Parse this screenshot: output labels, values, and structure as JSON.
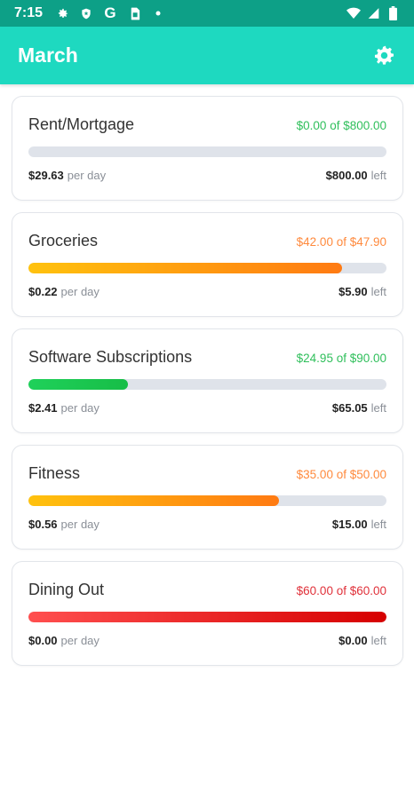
{
  "status_bar": {
    "time": "7:15",
    "left_icons": [
      "settings-icon",
      "shield-icon",
      "google-icon",
      "sim-card-icon",
      "dot-icon"
    ],
    "right_icons": [
      "wifi-icon",
      "signal-icon",
      "battery-icon"
    ]
  },
  "app_bar": {
    "title": "March",
    "settings_icon": "gear-icon",
    "background_color": "#1ed9c0"
  },
  "categories": [
    {
      "name": "Rent/Mortgage",
      "amount": "$0.00 of $800.00",
      "per_day": "$29.63",
      "per_day_unit": "per day",
      "left": "$800.00",
      "left_unit": "left",
      "progress": 0,
      "status": "green",
      "amount_color": "#2fbf5b",
      "bar_gradient": "#1fbe4a,#14c24a"
    },
    {
      "name": "Groceries",
      "amount": "$42.00 of $47.90",
      "per_day": "$0.22",
      "per_day_unit": "per day",
      "left": "$5.90",
      "left_unit": "left",
      "progress": 0.877,
      "status": "orange",
      "amount_color": "#ff8a3d",
      "bar_gradient": "#ffc20e,#ff7a12"
    },
    {
      "name": "Software Subscriptions",
      "amount": "$24.95 of $90.00",
      "per_day": "$2.41",
      "per_day_unit": "per day",
      "left": "$65.05",
      "left_unit": "left",
      "progress": 0.277,
      "status": "green",
      "amount_color": "#2fbf5b",
      "bar_gradient": "#1fd15a,#17bd47"
    },
    {
      "name": "Fitness",
      "amount": "$35.00 of $50.00",
      "per_day": "$0.56",
      "per_day_unit": "per day",
      "left": "$15.00",
      "left_unit": "left",
      "progress": 0.7,
      "status": "orange",
      "amount_color": "#ff8a3d",
      "bar_gradient": "#ffc20e,#ff7a12"
    },
    {
      "name": "Dining Out",
      "amount": "$60.00 of $60.00",
      "per_day": "$0.00",
      "per_day_unit": "per day",
      "left": "$0.00",
      "left_unit": "left",
      "progress": 1.0,
      "status": "red",
      "amount_color": "#e0313a",
      "bar_gradient": "#ff4f4f,#d60000"
    }
  ]
}
